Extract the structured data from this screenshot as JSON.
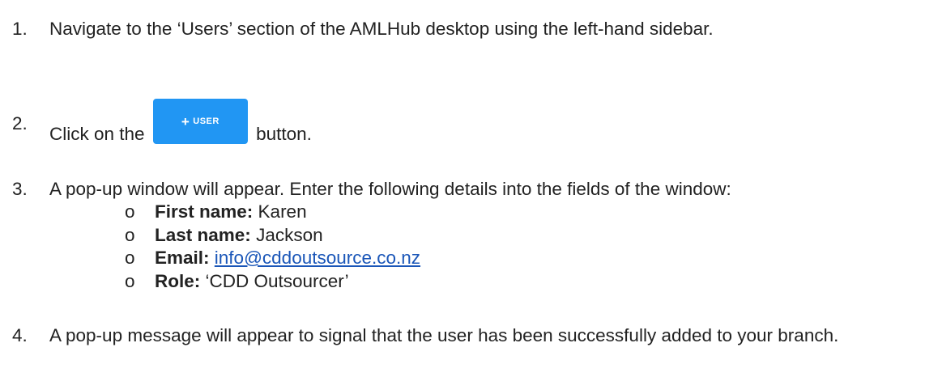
{
  "steps": [
    {
      "number": "1.",
      "text": "Navigate to the ‘Users’ section of the AMLHub desktop using the left-hand sidebar."
    },
    {
      "number": "2.",
      "before": "Click on the",
      "after": "button.",
      "button": {
        "icon": "plus-icon",
        "plus": "+",
        "label": "USER",
        "color": "#2196f3"
      }
    },
    {
      "number": "3.",
      "text": "A pop-up window will appear. Enter the following details into the fields of the window:",
      "bullet": "o",
      "details": [
        {
          "label": "First name:",
          "value": "Karen"
        },
        {
          "label": "Last name:",
          "value": "Jackson"
        },
        {
          "label": "Email:",
          "value": "info@cddoutsource.co.nz",
          "is_link": true
        },
        {
          "label": "Role:",
          "value": "‘CDD Outsourcer’"
        }
      ]
    },
    {
      "number": "4.",
      "text": "A pop-up message will appear to signal that the user has been successfully added to your branch."
    }
  ],
  "colors": {
    "text": "#222222",
    "link": "#1a56b8",
    "button": "#2196f3"
  }
}
